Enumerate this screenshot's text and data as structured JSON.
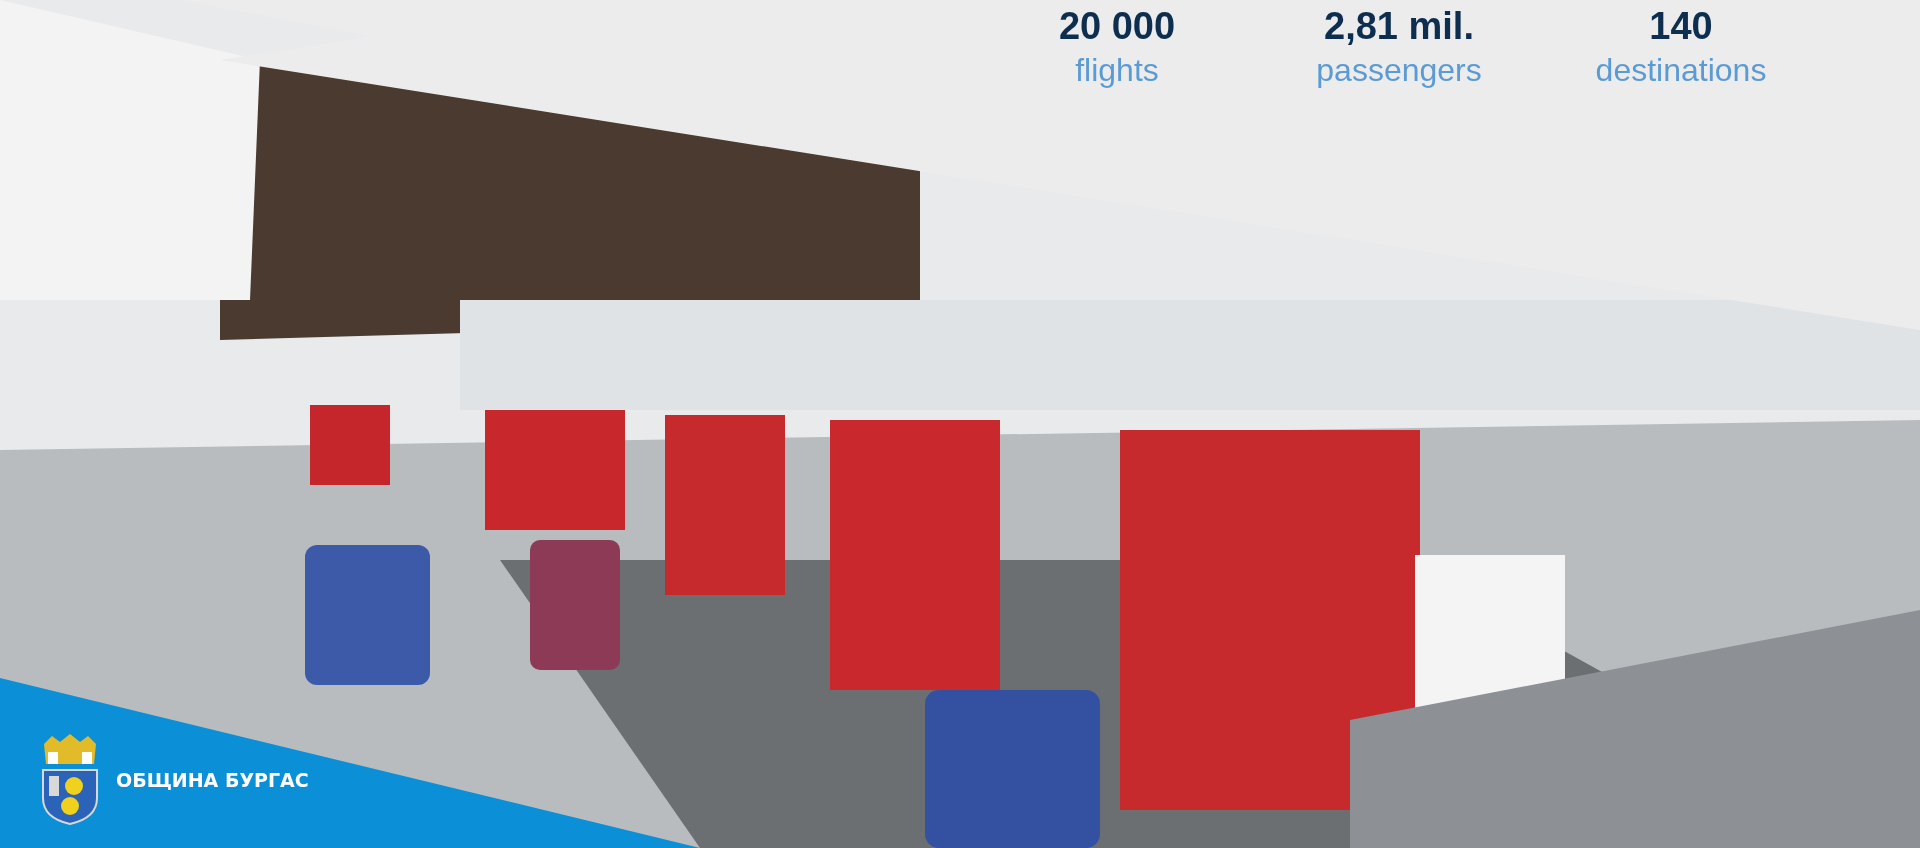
{
  "stats": [
    {
      "value": "20 000",
      "label": "flights"
    },
    {
      "value": "2,81 mil.",
      "label": "passengers"
    },
    {
      "value": "140",
      "label": "destinations"
    }
  ],
  "brand": {
    "name": "ОБЩИНА БУРГАС"
  }
}
